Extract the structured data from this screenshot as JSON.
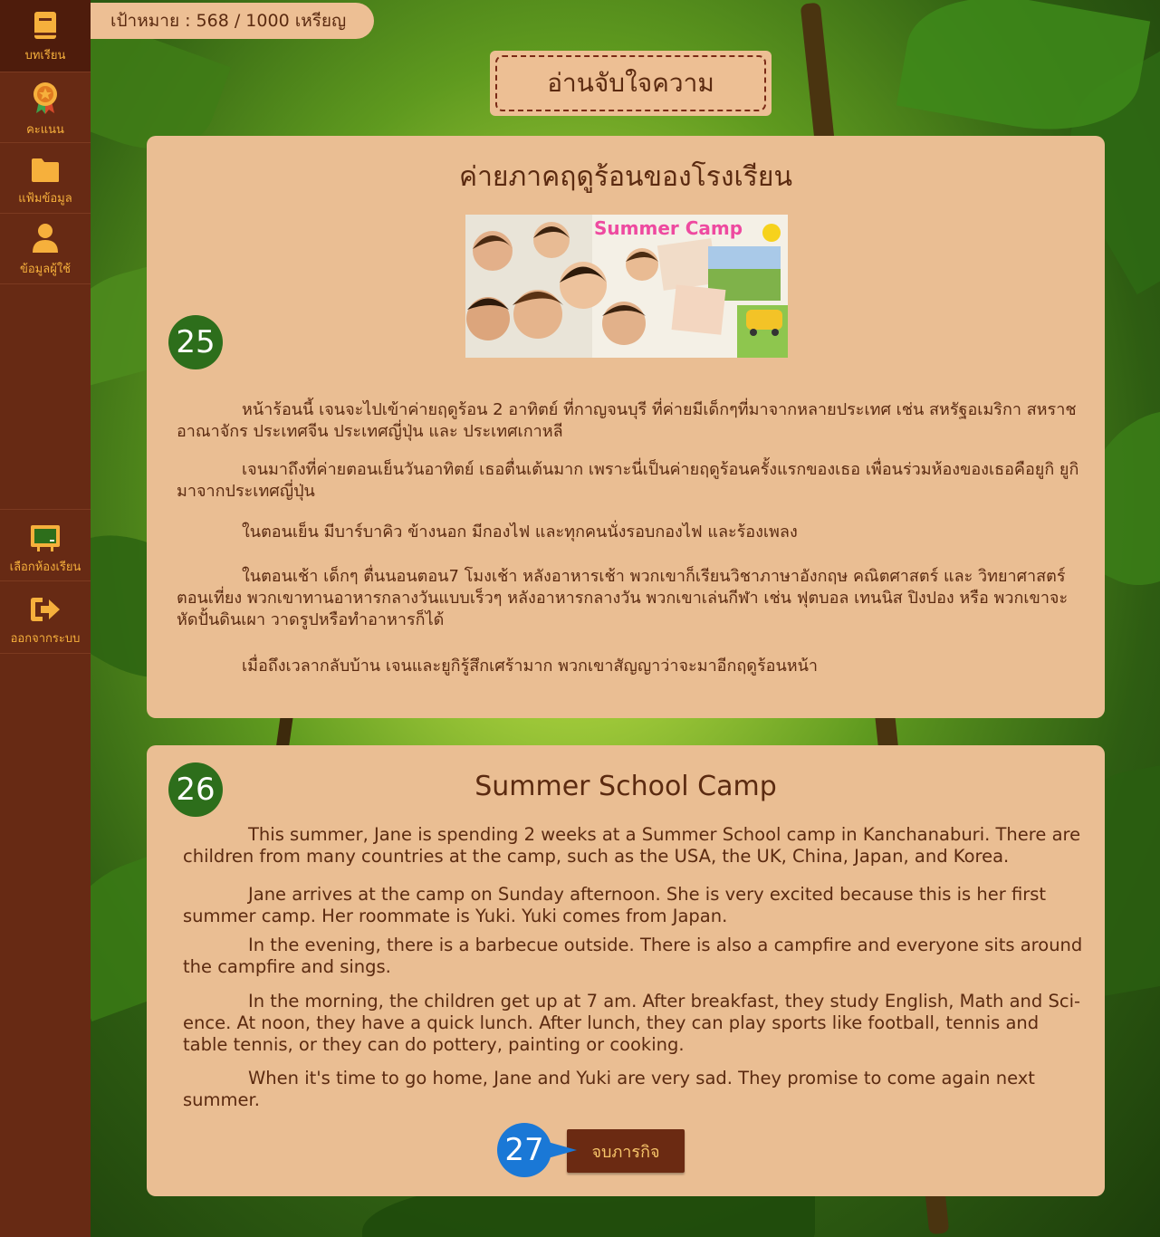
{
  "sidebar": {
    "items": [
      {
        "label": "บทเรียน",
        "icon": "book-icon"
      },
      {
        "label": "คะแนน",
        "icon": "medal-icon"
      },
      {
        "label": "แฟ้มข้อมูล",
        "icon": "folder-icon"
      },
      {
        "label": "ข้อมูลผู้ใช้",
        "icon": "user-icon"
      },
      {
        "label": "เลือกห้องเรียน",
        "icon": "classroom-board-icon"
      },
      {
        "label": "ออกจากระบบ",
        "icon": "logout-icon"
      }
    ]
  },
  "goal": {
    "text": "เป้าหมาย : 568 / 1000 เหรียญ"
  },
  "section_title": "อ่านจับใจความ",
  "thai_card": {
    "badge": "25",
    "title": "ค่ายภาคฤดูร้อนของโรงเรียน",
    "photo_caption": "Summer Camp",
    "paragraphs": [
      "หน้าร้อนนี้ เจนจะไปเข้าค่ายฤดูร้อน 2 อาทิตย์ ที่กาญจนบุรี ที่ค่ายมีเด็กๆที่มาจากหลายประเทศ เช่น สหรัฐอเมริกา สหราชอาณาจักร ประเทศจีน ประเทศญี่ปุ่น และ ประเทศเกาหลี",
      "เจนมาถึงที่ค่ายตอนเย็นวันอาทิตย์ เธอตื่นเต้นมาก เพราะนี่เป็นค่ายฤดูร้อนครั้งแรกของเธอ เพื่อนร่วมห้องของเธอคือยูกิ ยูกิมาจากประเทศญี่ปุ่น",
      "ในตอนเย็น มีบาร์บาคิว ข้างนอก มีกองไฟ และทุกคนนั่งรอบกองไฟ และร้องเพลง",
      "ในตอนเช้า เด็กๆ ตื่นนอนตอน7 โมงเช้า หลังอาหารเช้า พวกเขาก็เรียนวิชาภาษาอังกฤษ คณิตศาสตร์ และ วิทยาศาสตร์ ตอนเที่ยง พวกเขาทานอาหารกลางวันแบบเร็วๆ หลังอาหารกลางวัน พวกเขาเล่นกีฬา เช่น ฟุตบอล เทนนิส ปิงปอง หรือ พวกเขาจะหัดปั้นดินเผา วาดรูปหรือทำอาหารก็ได้",
      "เมื่อถึงเวลากลับบ้าน เจนและยูกิรู้สึกเศร้ามาก พวกเขาสัญญาว่าจะมาอีกฤดูร้อนหน้า"
    ]
  },
  "english_card": {
    "badge": "26",
    "title": "Summer School Camp",
    "paragraphs": [
      "This summer, Jane is spending 2 weeks at a Summer School camp in Kanchanaburi. There are children from many countries at the camp, such as the USA, the UK, China, Japan, and Korea.",
      "Jane arrives at the camp on Sunday afternoon. She is very excited because this is her first summer camp. Her roommate is Yuki. Yuki comes from Japan.",
      "In the evening, there is a barbecue outside. There is also a campfire and everyone sits around the campfire and sings.",
      "In the morning, the children get up at 7 am. After breakfast, they study English, Math and Sci- ence. At noon, they have a quick lunch. After lunch, they can play sports like football, tennis and table tennis, or they can do pottery, painting or cooking.",
      "When it's time to go home, Jane and Yuki are very sad. They promise to come again next summer."
    ],
    "finish_button": "จบภารกิจ",
    "step_badge": "27"
  },
  "colors": {
    "sidebar": "#672a14",
    "accent_orange": "#f6b03c",
    "card": "#eabe93",
    "text_brown": "#5b2a10",
    "badge_green": "#2d6e1b",
    "badge_blue": "#1a78d6"
  }
}
